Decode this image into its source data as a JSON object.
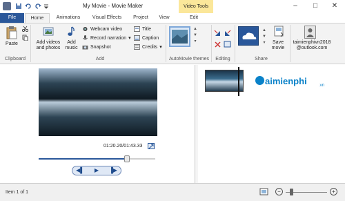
{
  "window": {
    "title": "My Movie - Movie Maker",
    "context_tab": "Video Tools"
  },
  "tabs": [
    {
      "label": "File"
    },
    {
      "label": "Home"
    },
    {
      "label": "Animations"
    },
    {
      "label": "Visual Effects"
    },
    {
      "label": "Project"
    },
    {
      "label": "View"
    },
    {
      "label": "Edit"
    }
  ],
  "ribbon": {
    "clipboard": {
      "paste": "Paste",
      "group": "Clipboard"
    },
    "add": {
      "add_videos": "Add videos and photos",
      "add_music": "Add music",
      "webcam": "Webcam video",
      "record_narration": "Record narration",
      "snapshot": "Snapshot",
      "title": "Title",
      "caption": "Caption",
      "credits": "Credits",
      "group": "Add"
    },
    "automovie": {
      "group": "AutoMovie themes"
    },
    "editing": {
      "group": "Editing"
    },
    "share": {
      "save_movie": "Save movie",
      "group": "Share"
    },
    "account": {
      "name": "taimienphivn2018",
      "email": "@outlook.com"
    }
  },
  "preview": {
    "time": "01:20.20/01:43.33",
    "progress": 0.76
  },
  "status": {
    "item": "Item 1 of 1",
    "zoom_level": 0.1
  },
  "watermark": {
    "brand": "aimienphi",
    "tld": ".vn"
  },
  "colors": {
    "accent": "#2a579a",
    "context_tab": "#fbe79a"
  }
}
